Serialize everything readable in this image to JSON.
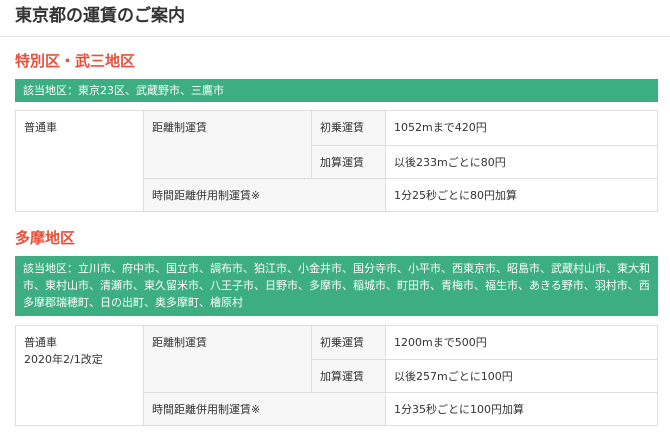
{
  "page": {
    "title": "東京都の運賃のご案内"
  },
  "sections": [
    {
      "heading": "特別区・武三地区",
      "area_text": "該当地区：東京23区、武蔵野市、三鷹市",
      "table": {
        "vehicle": "普通車",
        "vehicle_note": "",
        "distance_fare_label": "距離制運賃",
        "initial_label": "初乗運賃",
        "initial_value": "1052mまで420円",
        "additional_label": "加算運賃",
        "additional_value": "以後233mごとに80円",
        "time_distance_label": "時間距離併用制運賃※",
        "time_distance_value": "1分25秒ごとに80円加算"
      }
    },
    {
      "heading": "多摩地区",
      "area_text": "該当地区：立川市、府中市、国立市、調布市、狛江市、小金井市、国分寺市、小平市、西東京市、昭島市、武蔵村山市、東大和市、東村山市、清瀬市、東久留米市、八王子市、日野市、多摩市、稲城市、町田市、青梅市、福生市、あきる野市、羽村市、西多摩郡瑞穂町、日の出町、奥多摩町、檜原村",
      "table": {
        "vehicle": "普通車",
        "vehicle_note": "2020年2/1改定",
        "distance_fare_label": "距離制運賃",
        "initial_label": "初乗運賃",
        "initial_value": "1200mまで500円",
        "additional_label": "加算運賃",
        "additional_value": "以後257mごとに100円",
        "time_distance_label": "時間距離併用制運賃※",
        "time_distance_value": "1分35秒ごとに100円加算"
      }
    }
  ],
  "colors": {
    "heading": "#e8503a",
    "area_bg": "#3dae82",
    "area_text": "#ffffff",
    "label_cell_bg": "#f7f7f7",
    "border": "#dddddd"
  }
}
